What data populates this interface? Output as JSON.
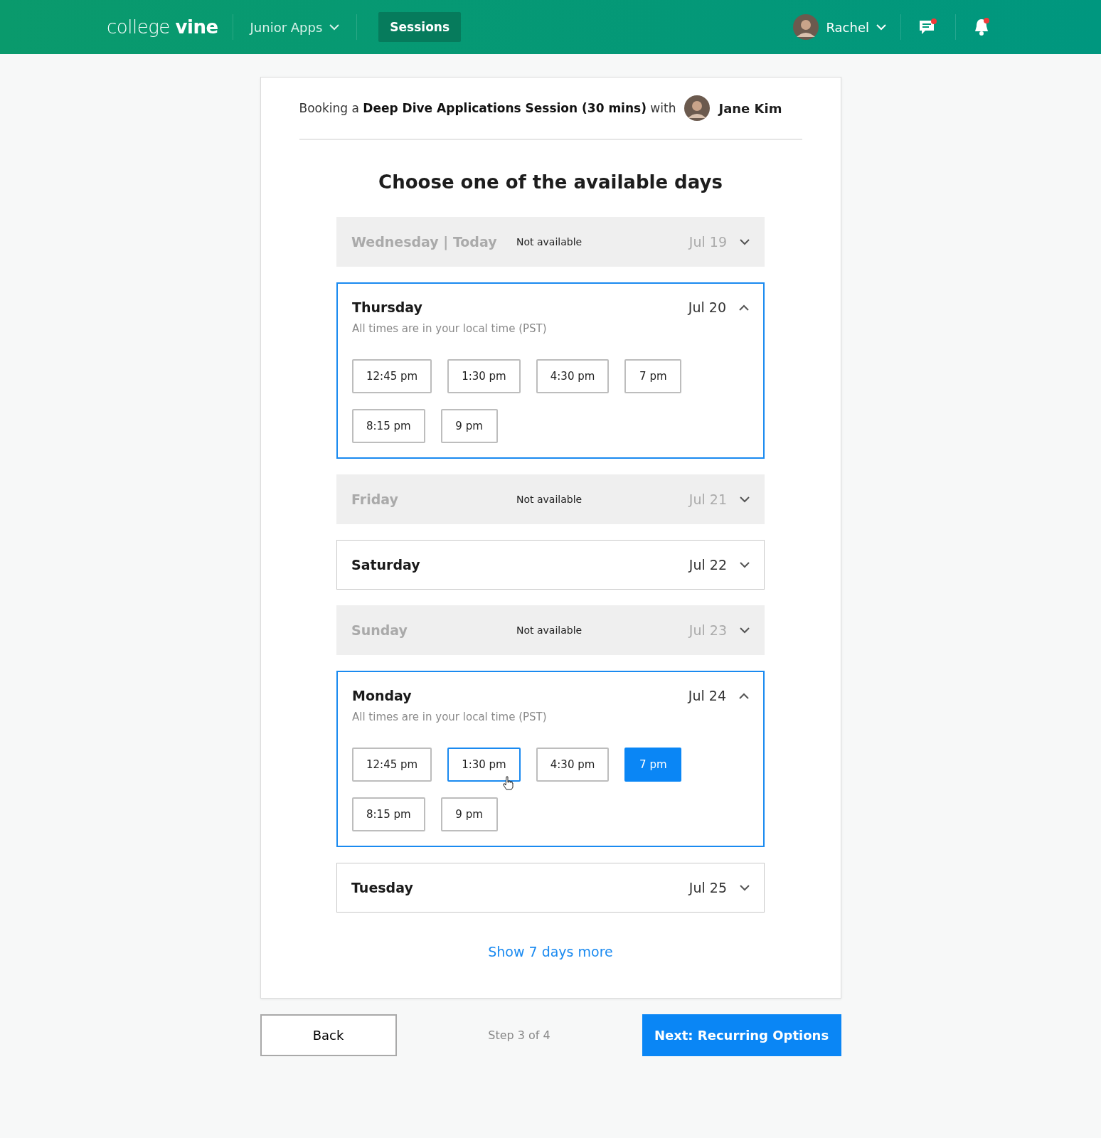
{
  "nav": {
    "logo": "college **vine**",
    "menu": "Junior Apps",
    "tab": {
      "label": "Sessions",
      "selected": true
    },
    "user": "Rachel",
    "messages_unread": true,
    "notifications_unread": true
  },
  "booking": {
    "text": "Booking a **Deep Dive Applications Session (30 mins)** with",
    "advisor": "Jane Kim"
  },
  "heading": "Choose one of the available days",
  "days": [
    {
      "name": "Wednesday | Today",
      "date": "Jul 19",
      "kind": "unavailable",
      "status": "Not available",
      "expanded": false
    },
    {
      "name": "Thursday",
      "date": "Jul 20",
      "kind": "available",
      "expanded": true,
      "note": "All times are in your local time (PST)",
      "slots": [
        {
          "time": "12:45 pm",
          "selected": false,
          "hovered": false
        },
        {
          "time": "1:30 pm",
          "selected": false,
          "hovered": false
        },
        {
          "time": "4:30 pm",
          "selected": false,
          "hovered": false
        },
        {
          "time": "7 pm",
          "selected": false,
          "hovered": false
        },
        {
          "time": "8:15 pm",
          "selected": false,
          "hovered": false
        },
        {
          "time": "9 pm",
          "selected": false,
          "hovered": false
        }
      ]
    },
    {
      "name": "Friday",
      "date": "Jul 21",
      "kind": "unavailable",
      "status": "Not available",
      "expanded": false
    },
    {
      "name": "Saturday",
      "date": "Jul 22",
      "kind": "available",
      "expanded": false
    },
    {
      "name": "Sunday",
      "date": "Jul 23",
      "kind": "unavailable",
      "status": "Not available",
      "expanded": false
    },
    {
      "name": "Monday",
      "date": "Jul 24",
      "kind": "available",
      "expanded": true,
      "note": "All times are in your local time (PST)",
      "slots": [
        {
          "time": "12:45 pm",
          "selected": false,
          "hovered": false
        },
        {
          "time": "1:30 pm",
          "selected": false,
          "hovered": true
        },
        {
          "time": "4:30 pm",
          "selected": false,
          "hovered": false
        },
        {
          "time": "7 pm",
          "selected": true,
          "hovered": false
        },
        {
          "time": "8:15 pm",
          "selected": false,
          "hovered": false
        },
        {
          "time": "9 pm",
          "selected": false,
          "hovered": false
        }
      ]
    },
    {
      "name": "Tuesday",
      "date": "Jul 25",
      "kind": "available",
      "expanded": false
    }
  ],
  "more_link": "Show 7 days more",
  "footer": {
    "back": "Back",
    "step": "Step 3 of 4",
    "next": "Next: Recurring Options"
  }
}
